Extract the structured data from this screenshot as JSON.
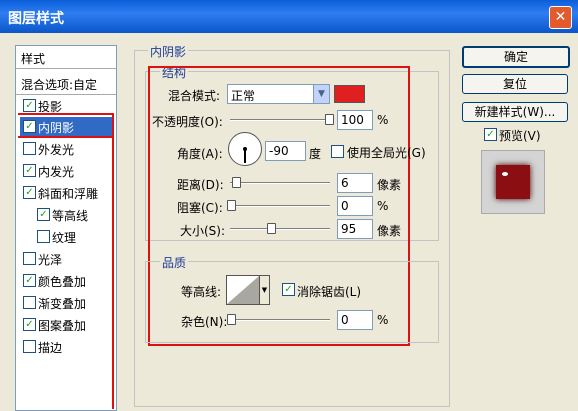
{
  "window": {
    "title": "图层样式",
    "close_glyph": "✕"
  },
  "left_panel": {
    "header": "样式",
    "blend_options": "混合选项:自定",
    "items": [
      {
        "label": "投影",
        "checked": true
      },
      {
        "label": "内阴影",
        "checked": true,
        "selected": true
      },
      {
        "label": "外发光",
        "checked": false
      },
      {
        "label": "内发光",
        "checked": true
      },
      {
        "label": "斜面和浮雕",
        "checked": true
      },
      {
        "label": "等高线",
        "checked": true
      },
      {
        "label": "纹理",
        "checked": false
      },
      {
        "label": "光泽",
        "checked": false
      },
      {
        "label": "颜色叠加",
        "checked": true
      },
      {
        "label": "渐变叠加",
        "checked": false
      },
      {
        "label": "图案叠加",
        "checked": true
      },
      {
        "label": "描边",
        "checked": false
      }
    ]
  },
  "inner_shadow": {
    "section_title": "内阴影",
    "structure": {
      "title": "结构",
      "blend_mode_label": "混合模式:",
      "blend_mode_value": "正常",
      "color": "#e02020",
      "opacity_label": "不透明度(O):",
      "opacity_value": "100",
      "opacity_unit": "%",
      "angle_label": "角度(A):",
      "angle_value": "-90",
      "angle_unit": "度",
      "global_light_label": "使用全局光(G)",
      "distance_label": "距离(D):",
      "distance_value": "6",
      "distance_unit": "像素",
      "choke_label": "阻塞(C):",
      "choke_value": "0",
      "choke_unit": "%",
      "size_label": "大小(S):",
      "size_value": "95",
      "size_unit": "像素"
    },
    "quality": {
      "title": "品质",
      "contour_label": "等高线:",
      "antialias_label": "消除锯齿(L)",
      "noise_label": "杂色(N):",
      "noise_value": "0",
      "noise_unit": "%"
    }
  },
  "buttons": {
    "ok": "确定",
    "reset": "复位",
    "new_style": "新建样式(W)...",
    "preview": "预览(V)"
  },
  "dropdown_glyph": "▼",
  "check_glyph": "✓",
  "preview_color": "#8b0f12"
}
